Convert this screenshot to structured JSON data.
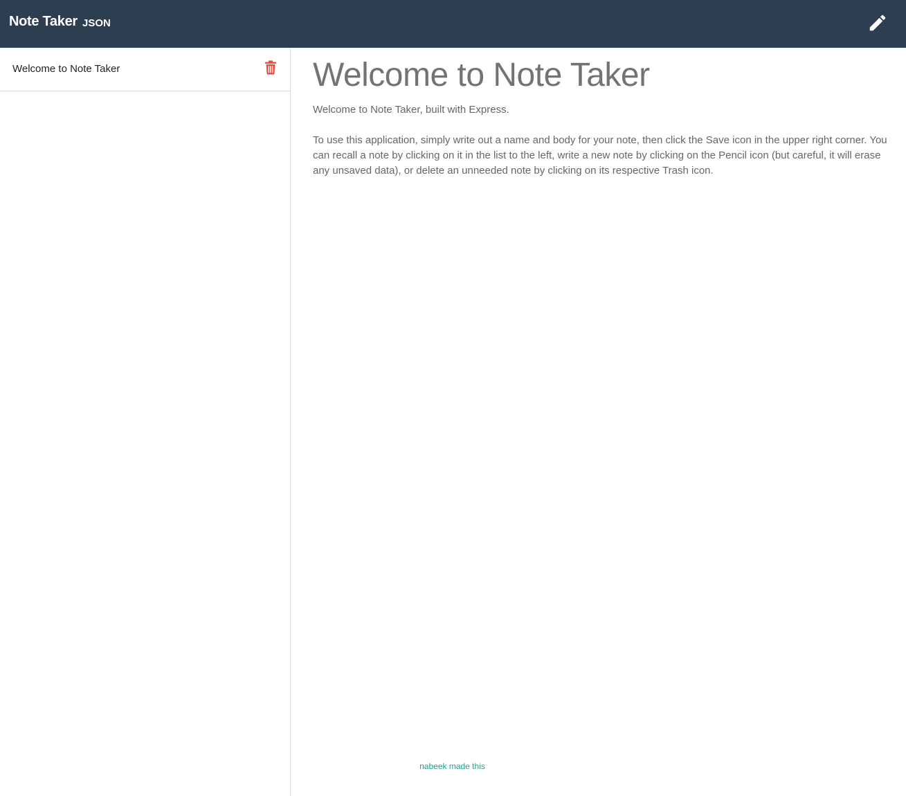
{
  "navbar": {
    "brand": "Note Taker",
    "json_link": "JSON",
    "new_note_icon": "pencil-icon",
    "background": "#2e3e51"
  },
  "sidebar": {
    "notes": [
      {
        "title": "Welcome to Note Taker",
        "delete_icon": "trash-icon"
      }
    ]
  },
  "note": {
    "title": "Welcome to Note Taker",
    "body": "Welcome to Note Taker, built with Express.\n\nTo use this application, simply write out a name and body for your note, then click the Save icon in the upper right corner. You can recall a note by clicking on it in the list to the left, write a new note by clicking on the Pencil icon (but careful, it will erase any unsaved data), or delete an unneeded note by clicking on its respective Trash icon."
  },
  "footer": {
    "text": "nabeek made this"
  },
  "colors": {
    "navbar": "#2e3e51",
    "delete": "#e74c3c",
    "footer_link": "#1aa38a",
    "title_text": "#737373"
  }
}
